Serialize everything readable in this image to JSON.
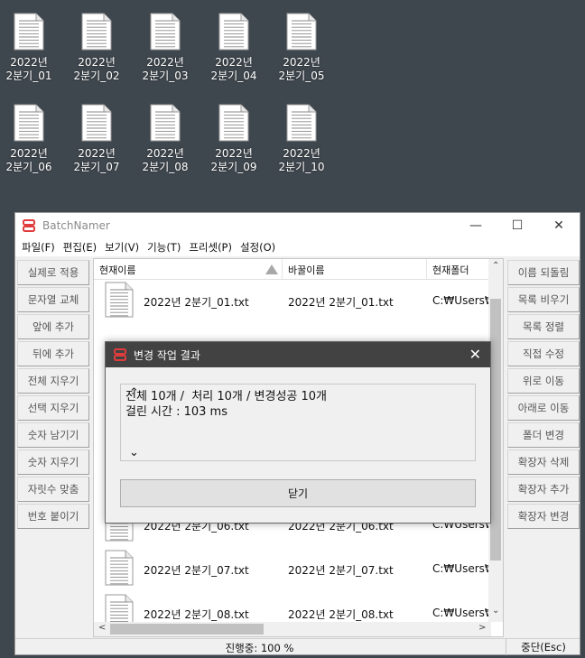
{
  "desktop": {
    "files": [
      {
        "line1": "2022년",
        "line2": "2분기_01"
      },
      {
        "line1": "2022년",
        "line2": "2분기_02"
      },
      {
        "line1": "2022년",
        "line2": "2분기_03"
      },
      {
        "line1": "2022년",
        "line2": "2분기_04"
      },
      {
        "line1": "2022년",
        "line2": "2분기_05"
      },
      {
        "line1": "2022년",
        "line2": "2분기_06"
      },
      {
        "line1": "2022년",
        "line2": "2분기_07"
      },
      {
        "line1": "2022년",
        "line2": "2분기_08"
      },
      {
        "line1": "2022년",
        "line2": "2분기_09"
      },
      {
        "line1": "2022년",
        "line2": "2분기_10"
      }
    ]
  },
  "window": {
    "title": "BatchNamer",
    "accent": "#e03c3c",
    "controls": {
      "minimize": "—",
      "maximize": "☐",
      "close": "✕"
    },
    "menu": [
      "파일(F)",
      "편집(E)",
      "보기(V)",
      "기능(T)",
      "프리셋(P)",
      "설정(O)"
    ],
    "left_buttons": [
      "실제로 적용",
      "문자열 교체",
      "앞에 추가",
      "뒤에 추가",
      "전체 지우기",
      "선택 지우기",
      "숫자 남기기",
      "숫자 지우기",
      "자릿수 맞춤",
      "번호 붙이기"
    ],
    "right_buttons": [
      "이름 되돌림",
      "목록 비우기",
      "목록 정렬",
      "직접 수정",
      "위로 이동",
      "아래로 이동",
      "폴더 변경",
      "확장자 삭제",
      "확장자 추가",
      "확장자 변경"
    ],
    "list": {
      "columns": [
        "현재이름",
        "바꿀이름",
        "현재폴더"
      ],
      "rows": [
        {
          "current": "2022년 2분기_01.txt",
          "new": "2022년 2분기_01.txt",
          "folder": "C:₩Users₩"
        },
        {
          "current": "2022년 2분기_06.txt",
          "new": "2022년 2분기_06.txt",
          "folder": "C:₩Users₩"
        },
        {
          "current": "2022년 2분기_07.txt",
          "new": "2022년 2분기_07.txt",
          "folder": "C:₩Users₩"
        },
        {
          "current": "2022년 2분기_08.txt",
          "new": "2022년 2분기_08.txt",
          "folder": "C:₩Users₩"
        }
      ]
    },
    "status": {
      "progress_text": "진행중: 100 %",
      "stop_label": "중단(Esc)"
    }
  },
  "dialog": {
    "title": "변경 작업 결과",
    "close": "✕",
    "line1": "전체 10개 /  처리 10개 / 변경성공 10개",
    "line2": "걸린 시간 : 103 ms",
    "button": "닫기"
  }
}
